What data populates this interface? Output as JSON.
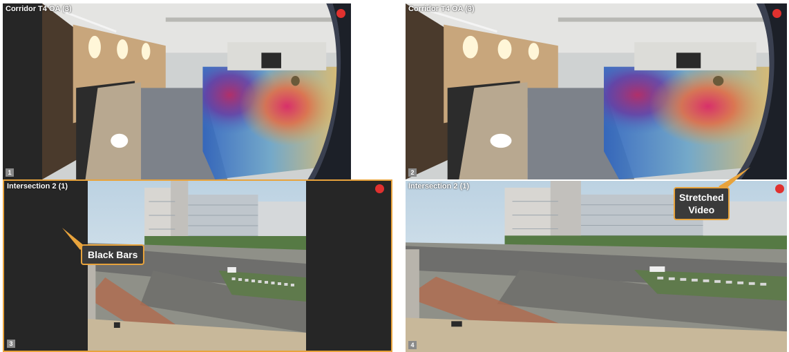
{
  "tiles": [
    {
      "title": "Corridor T4 OA (3)",
      "number": "1"
    },
    {
      "title": "Corridor T4 OA (3)",
      "number": "2"
    },
    {
      "title": "Intersection 2 (1)",
      "number": "3"
    },
    {
      "title": "Intersection 2 (1)",
      "number": "4"
    }
  ],
  "callouts": {
    "black_bars": "Black Bars",
    "stretched_line1": "Stretched",
    "stretched_line2": "Video"
  },
  "colors": {
    "accent": "#e8a33c",
    "record": "#e0312f",
    "tile_bg": "#262626"
  },
  "icons": [
    "record-indicator-icon"
  ]
}
